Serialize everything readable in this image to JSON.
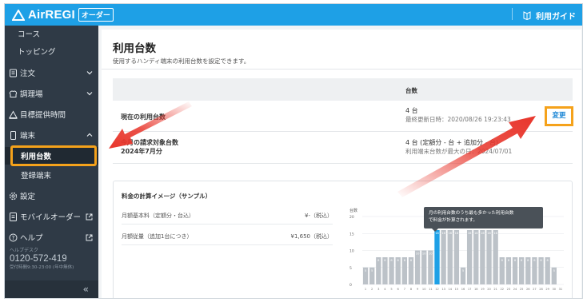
{
  "header": {
    "brand": "AirREGI",
    "brand_tag": "オーダー",
    "guide_label": "利用ガイド",
    "colors": {
      "bar": "#1ea0e6",
      "highlight": "#f5a21b",
      "arrow": "#e8352b"
    }
  },
  "sidebar": {
    "items": [
      {
        "label": "コース"
      },
      {
        "label": "トッピング"
      },
      {
        "label": "注文"
      },
      {
        "label": "調理場"
      },
      {
        "label": "目標提供時間"
      },
      {
        "label": "端末"
      },
      {
        "label": "利用台数"
      },
      {
        "label": "登録端末"
      },
      {
        "label": "設定"
      },
      {
        "label": "モバイルオーダー"
      },
      {
        "label": "ヘルプ"
      }
    ],
    "helpdesk": {
      "label": "ヘルプデスク",
      "phone": "0120-572-419",
      "hours": "受付時間9:30-23:00 (年中無休)"
    },
    "collapse_symbol": "«"
  },
  "main": {
    "title": "利用台数",
    "subtitle": "使用するハンディ端末の利用台数を設定できます。",
    "table": {
      "col_header": "台数",
      "rows": [
        {
          "label": "現在の利用台数",
          "value": "4 台",
          "detail": "最終更新日時：2020/08/26 19:23:43",
          "action": "変更"
        },
        {
          "label": "今月の請求対象台数",
          "label2": "2024年7月分",
          "value": "4 台 (定額分 - 台 + 追加分 - 台)",
          "detail": "利用端末台数が最大の日：2024/07/01"
        }
      ]
    },
    "calc": {
      "title": "料金の計算イメージ（サンプル）",
      "fees": [
        {
          "label": "月額基本料（定額分・台込）",
          "value": "¥-（税込）"
        },
        {
          "label": "月額従量（追加1台につき）",
          "value": "¥1,650（税込）"
        }
      ]
    }
  },
  "chart_data": {
    "type": "bar",
    "ylabel": "台数",
    "ylim": [
      0,
      20
    ],
    "yticks": [
      "20",
      "15",
      "10",
      "5",
      "0"
    ],
    "categories": [
      "1",
      "2",
      "3",
      "4",
      "5",
      "6",
      "7",
      "8",
      "9",
      "10",
      "11",
      "12",
      "13",
      "14",
      "15",
      "16",
      "17",
      "18",
      "19",
      "20",
      "21",
      "22",
      "23",
      "24",
      "25",
      "26",
      "27",
      "28",
      "29",
      "30",
      "31"
    ],
    "values": [
      5,
      5,
      8,
      8,
      8,
      8,
      8,
      8,
      10,
      10,
      10,
      16,
      16,
      16,
      16,
      5,
      16,
      16,
      16,
      16,
      16,
      8,
      8,
      8,
      8,
      8,
      8,
      8,
      8,
      5,
      0
    ],
    "highlight_index": 11,
    "bar_labels": [
      "5",
      "5",
      "8",
      "8",
      "8",
      "8",
      "8",
      "8",
      "10",
      "10",
      "10",
      "16",
      "16",
      "16",
      "16",
      "5",
      "16",
      "16",
      "16",
      "16",
      "16",
      "8",
      "8",
      "8",
      "8",
      "8",
      "8",
      "8",
      "8",
      "5",
      ""
    ],
    "tooltip": [
      "月の利用台数のうち最も多かった利用台数",
      "で料金が計算されます。"
    ]
  }
}
